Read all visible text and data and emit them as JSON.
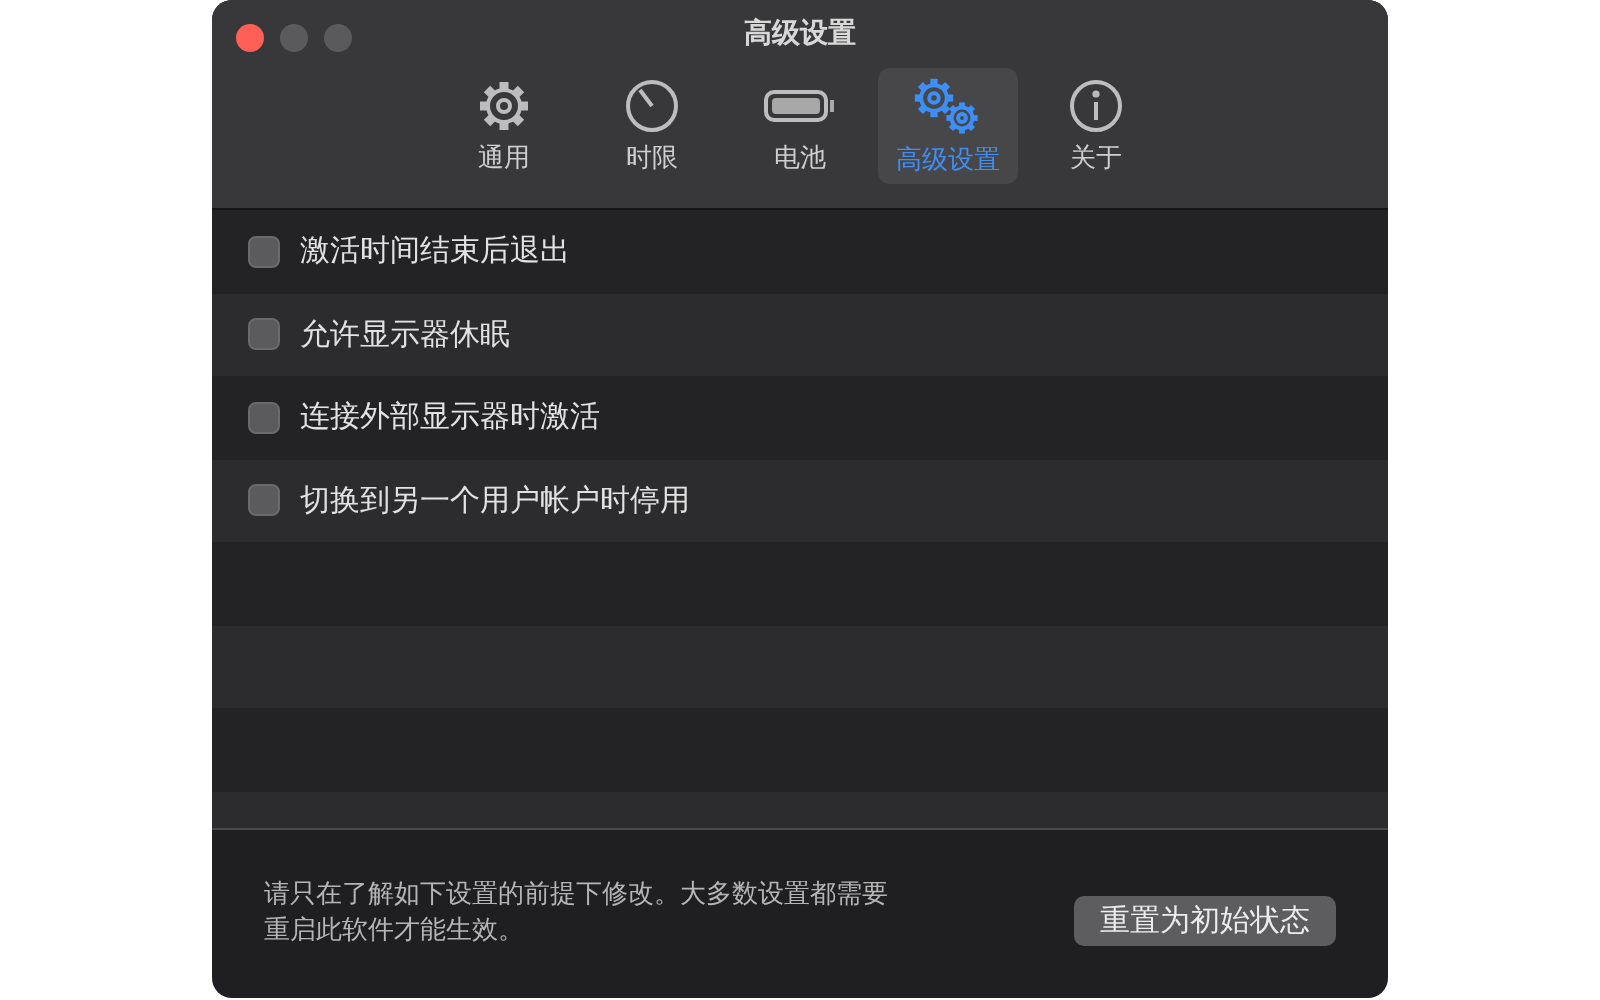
{
  "window": {
    "title": "高级设置"
  },
  "tabs": [
    {
      "label": "通用",
      "kind": "gear",
      "selected": false
    },
    {
      "label": "时限",
      "kind": "timer",
      "selected": false
    },
    {
      "label": "电池",
      "kind": "battery",
      "selected": false
    },
    {
      "label": "高级设置",
      "kind": "gears",
      "selected": true
    },
    {
      "label": "关于",
      "kind": "info",
      "selected": false
    }
  ],
  "options": [
    {
      "label": "激活时间结束后退出",
      "checked": false
    },
    {
      "label": "允许显示器休眠",
      "checked": false
    },
    {
      "label": "连接外部显示器时激活",
      "checked": false
    },
    {
      "label": "切换到另一个用户帐户时停用",
      "checked": false
    }
  ],
  "footer": {
    "note": "请只在了解如下设置的前提下修改。大多数设置都需要重启此软件才能生效。",
    "button": "重置为初始状态"
  }
}
